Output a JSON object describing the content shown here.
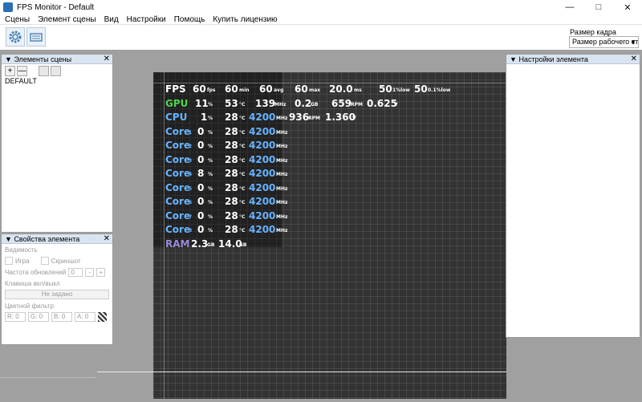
{
  "window": {
    "title": "FPS Monitor - Default",
    "minimize_icon": "minimize-icon",
    "maximize_icon": "maximize-icon",
    "close_icon": "close-icon"
  },
  "menu": [
    "Сцены",
    "Элемент сцены",
    "Вид",
    "Настройки",
    "Помощь",
    "Купить лицензию"
  ],
  "toolbar": {
    "frame_size_label": "Размер кадра",
    "frame_size_value": "Размер рабочего ст"
  },
  "scene_panel": {
    "title": "Элементы сцены",
    "items": [
      "DEFAULT"
    ]
  },
  "props_panel": {
    "title": "Свойства элемента",
    "visibility_label": "Видимость",
    "game_label": "Игра",
    "screenshot_label": "Скриншот",
    "refresh_label": "Частота обновлений",
    "refresh_value": "0",
    "hotkey_label": "Клавиша вкл/выкл",
    "hotkey_value": "Не задано",
    "color_filter_label": "Цветной фильтр",
    "r": "R:  0",
    "g": "G:  0",
    "b": "B:  0",
    "a": "A:  0"
  },
  "settings_panel": {
    "title": "Настройки элемента"
  },
  "osd": {
    "fps": {
      "label": "FPS",
      "v1": "60",
      "u1": "fps",
      "v2": "60",
      "u2": "min",
      "v3": "60",
      "u3": "avg",
      "v4": "60",
      "u4": "max",
      "v5": "20.0",
      "u5": "ms",
      "v6": "50",
      "u6": "1%low",
      "v7": "50",
      "u7": "0.1%low"
    },
    "gpu": {
      "label": "GPU",
      "load": "11",
      "load_u": "%",
      "temp": "53",
      "temp_u": "°C",
      "clock": "139",
      "clock_u": "MHz",
      "mem": "0.2",
      "mem_u": "GB",
      "rpm": "659",
      "rpm_u": "RPM",
      "volt": "0.625",
      "volt_u": "V"
    },
    "cpu": {
      "label": "CPU",
      "load": "1",
      "load_u": "%",
      "temp": "28",
      "temp_u": "°C",
      "clock": "4200",
      "clock_u": "MHz",
      "rpm": "936",
      "rpm_u": "RPM",
      "volt": "1.360",
      "volt_u": "V"
    },
    "cores": [
      {
        "label": "Core",
        "idx": "1",
        "load": "0",
        "temp": "28",
        "clock": "4200"
      },
      {
        "label": "Core",
        "idx": "2",
        "load": "0",
        "temp": "28",
        "clock": "4200"
      },
      {
        "label": "Core",
        "idx": "3",
        "load": "0",
        "temp": "28",
        "clock": "4200"
      },
      {
        "label": "Core",
        "idx": "4",
        "load": "8",
        "temp": "28",
        "clock": "4200"
      },
      {
        "label": "Core",
        "idx": "5",
        "load": "0",
        "temp": "28",
        "clock": "4200"
      },
      {
        "label": "Core",
        "idx": "6",
        "load": "0",
        "temp": "28",
        "clock": "4200"
      },
      {
        "label": "Core",
        "idx": "7",
        "load": "0",
        "temp": "28",
        "clock": "4200"
      },
      {
        "label": "Core",
        "idx": "8",
        "load": "0",
        "temp": "28",
        "clock": "4200"
      }
    ],
    "core_units": {
      "load": "%",
      "temp": "°C",
      "clock": "MHz"
    },
    "ram": {
      "label": "RAM",
      "used": "2.3",
      "used_u": "GB",
      "total": "14.0",
      "total_u": "GB"
    }
  },
  "colors": {
    "gpu": "#4fd34f",
    "cpu": "#66b3ff",
    "ram": "#9a8ad8",
    "panel_header": "#d9e4f1",
    "canvas": "#333333"
  }
}
